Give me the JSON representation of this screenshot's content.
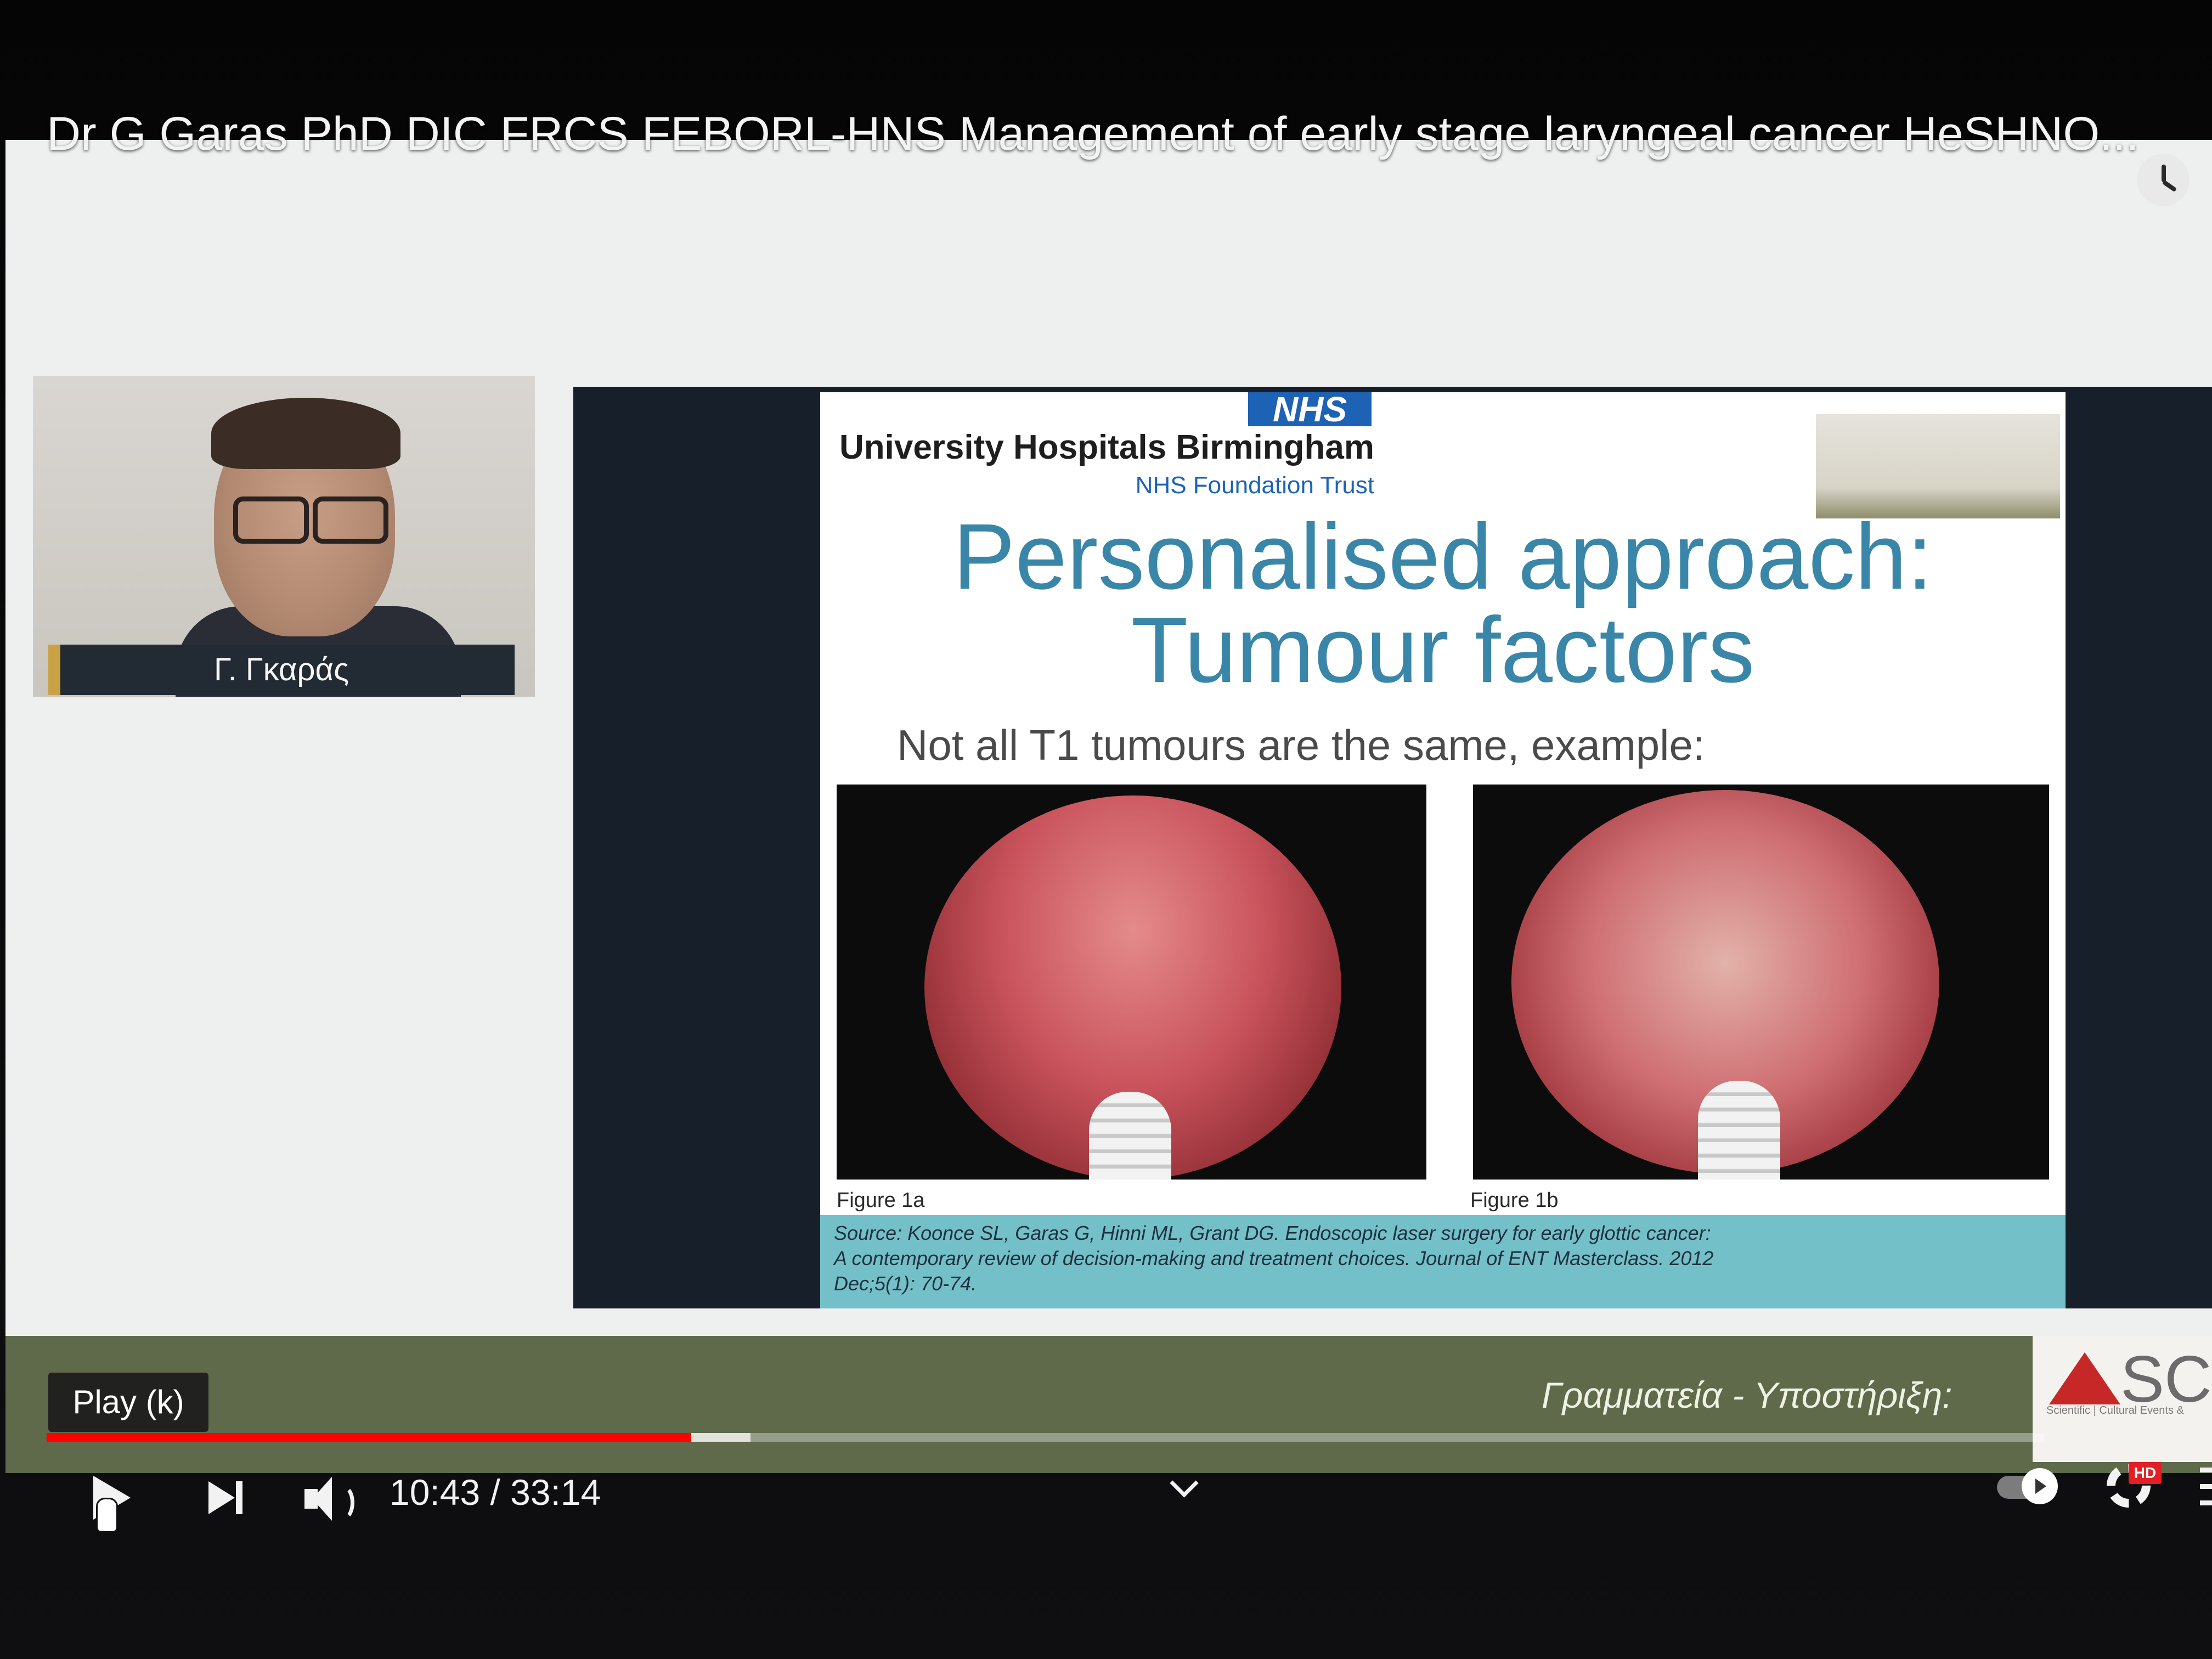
{
  "video": {
    "title": "Dr G Garas PhD DIC FRCS FEBORL-HNS Management of early stage laryngeal cancer HeSHNO...",
    "watch_later_icon": "clock-icon"
  },
  "webcam": {
    "name": "Γ. Γκαράς"
  },
  "slide": {
    "nhs_logo": "NHS",
    "hospital_name": "University Hospitals Birmingham",
    "hospital_subtitle": "NHS Foundation Trust",
    "title_line1": "Personalised approach:",
    "title_line2": "Tumour factors",
    "subtitle": "Not all T1 tumours are the same, example:",
    "figure_a_caption": "Figure 1a",
    "figure_b_caption": "Figure 1b",
    "source_lines": [
      "Source: Koonce SL, Garas G, Hinni ML, Grant DG. Endoscopic laser surgery for early glottic cancer:",
      "A contemporary review of decision-making and treatment choices. Journal of ENT Masterclass. 2012",
      "Dec;5(1): 70-74."
    ]
  },
  "banner": {
    "text": "Γραμματεία - Υποστήριξη:",
    "logo_text": "SCE",
    "logo_tagline": "Scientific | Cultural Events &"
  },
  "player": {
    "tooltip": "Play (k)",
    "current_time": "10:43",
    "duration": "33:14",
    "time_display": "10:43 / 33:14",
    "progress_played_fraction": 0.3228,
    "progress_buffered_fraction": 0.3525,
    "hd_badge": "HD",
    "colors": {
      "progress_played": "#ff0000",
      "hd_badge": "#e31e24",
      "banner": "#5e6a4a",
      "slide_title": "#3a86a8",
      "source_box": "#74c0c8",
      "nhs_blue": "#1d62b5"
    },
    "icons": {
      "play": "play-icon",
      "next": "next-icon",
      "volume": "volume-icon",
      "chevron": "chevron-down-icon",
      "autoplay": "autoplay-toggle-icon",
      "settings": "gear-icon",
      "menu": "menu-icon",
      "cursor": "hand-cursor-icon"
    }
  }
}
